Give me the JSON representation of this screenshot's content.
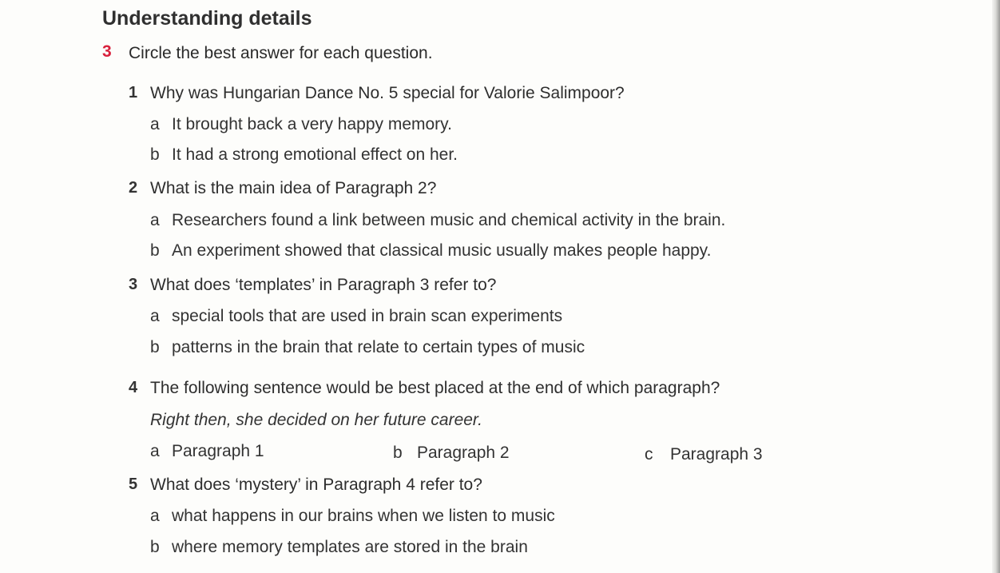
{
  "section_title": "Understanding details",
  "exercise": {
    "number": "3",
    "instruction": "Circle the best answer for each question."
  },
  "questions": [
    {
      "number": "1",
      "text": "Why was Hungarian Dance No. 5 special for Valorie Salimpoor?",
      "options": [
        {
          "letter": "a",
          "text": "It brought back a very happy memory."
        },
        {
          "letter": "b",
          "text": "It had a strong emotional effect on her."
        }
      ]
    },
    {
      "number": "2",
      "text": "What is the main idea of Paragraph 2?",
      "options": [
        {
          "letter": "a",
          "text": "Researchers found a link between music and chemical activity in the brain."
        },
        {
          "letter": "b",
          "text": "An experiment showed that classical music usually makes people happy."
        }
      ]
    },
    {
      "number": "3",
      "text": "What does ‘templates’ in Paragraph 3 refer to?",
      "options": [
        {
          "letter": "a",
          "text": "special tools that are used in brain scan experiments"
        },
        {
          "letter": "b",
          "text": "patterns in the brain that relate to certain types of music"
        }
      ]
    },
    {
      "number": "4",
      "text": "The following sentence would be best placed at the end of which paragraph?",
      "sentence": "Right then, she decided on her future career.",
      "options": [
        {
          "letter": "a",
          "text": "Paragraph 1"
        },
        {
          "letter": "b",
          "text": "Paragraph 2"
        },
        {
          "letter": "c",
          "text": "Paragraph 3"
        }
      ]
    },
    {
      "number": "5",
      "text": "What does ‘mystery’ in Paragraph 4 refer to?",
      "options": [
        {
          "letter": "a",
          "text": "what happens in our brains when we listen to music"
        },
        {
          "letter": "b",
          "text": "where memory templates are stored in the brain"
        }
      ]
    }
  ],
  "colors": {
    "exercise_number": "#d8203c",
    "text": "#2e2e2e"
  }
}
